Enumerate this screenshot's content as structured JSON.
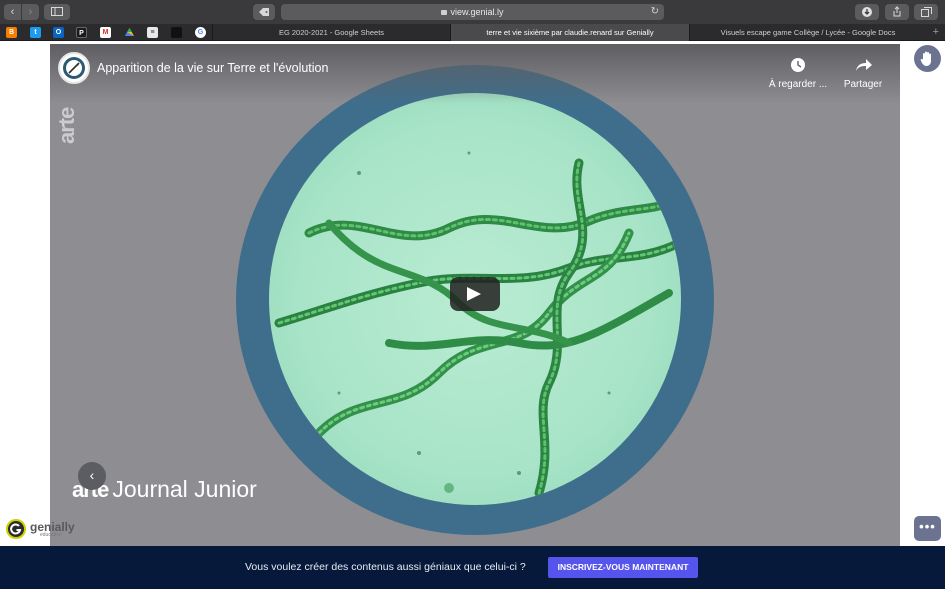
{
  "browser": {
    "address": "view.genial.ly",
    "tabs": [
      {
        "label": "EG 2020-2021 - Google Sheets",
        "active": false
      },
      {
        "label": "terre et vie sixième par claudie.renard sur Genially",
        "active": true
      },
      {
        "label": "Visuels escape game Collège / Lycée - Google Docs",
        "active": false
      }
    ],
    "favorites": [
      "blogger-icon",
      "twitter-icon",
      "outlook-icon",
      "pix-icon",
      "gmail-icon",
      "drive-icon",
      "stripes-icon",
      "dark-square-icon",
      "google-icon"
    ]
  },
  "video": {
    "title": "Apparition de la vie sur Terre et l'évolution",
    "watch_later": "À regarder ...",
    "share": "Partager",
    "watermark": "arte",
    "journal_brand": "arte",
    "journal_title": "Journal Junior"
  },
  "genially": {
    "logo_text": "genially",
    "logo_sub": "education"
  },
  "banner": {
    "text": "Vous voulez créer des contenus aussi géniaux que celui-ci ?",
    "cta": "INSCRIVEZ-VOUS MAINTENANT"
  },
  "colors": {
    "banner_bg": "#07193b",
    "cta_bg": "#5555ee",
    "action_button": "#6b7391",
    "scope_ring": "#3f6e8c"
  }
}
